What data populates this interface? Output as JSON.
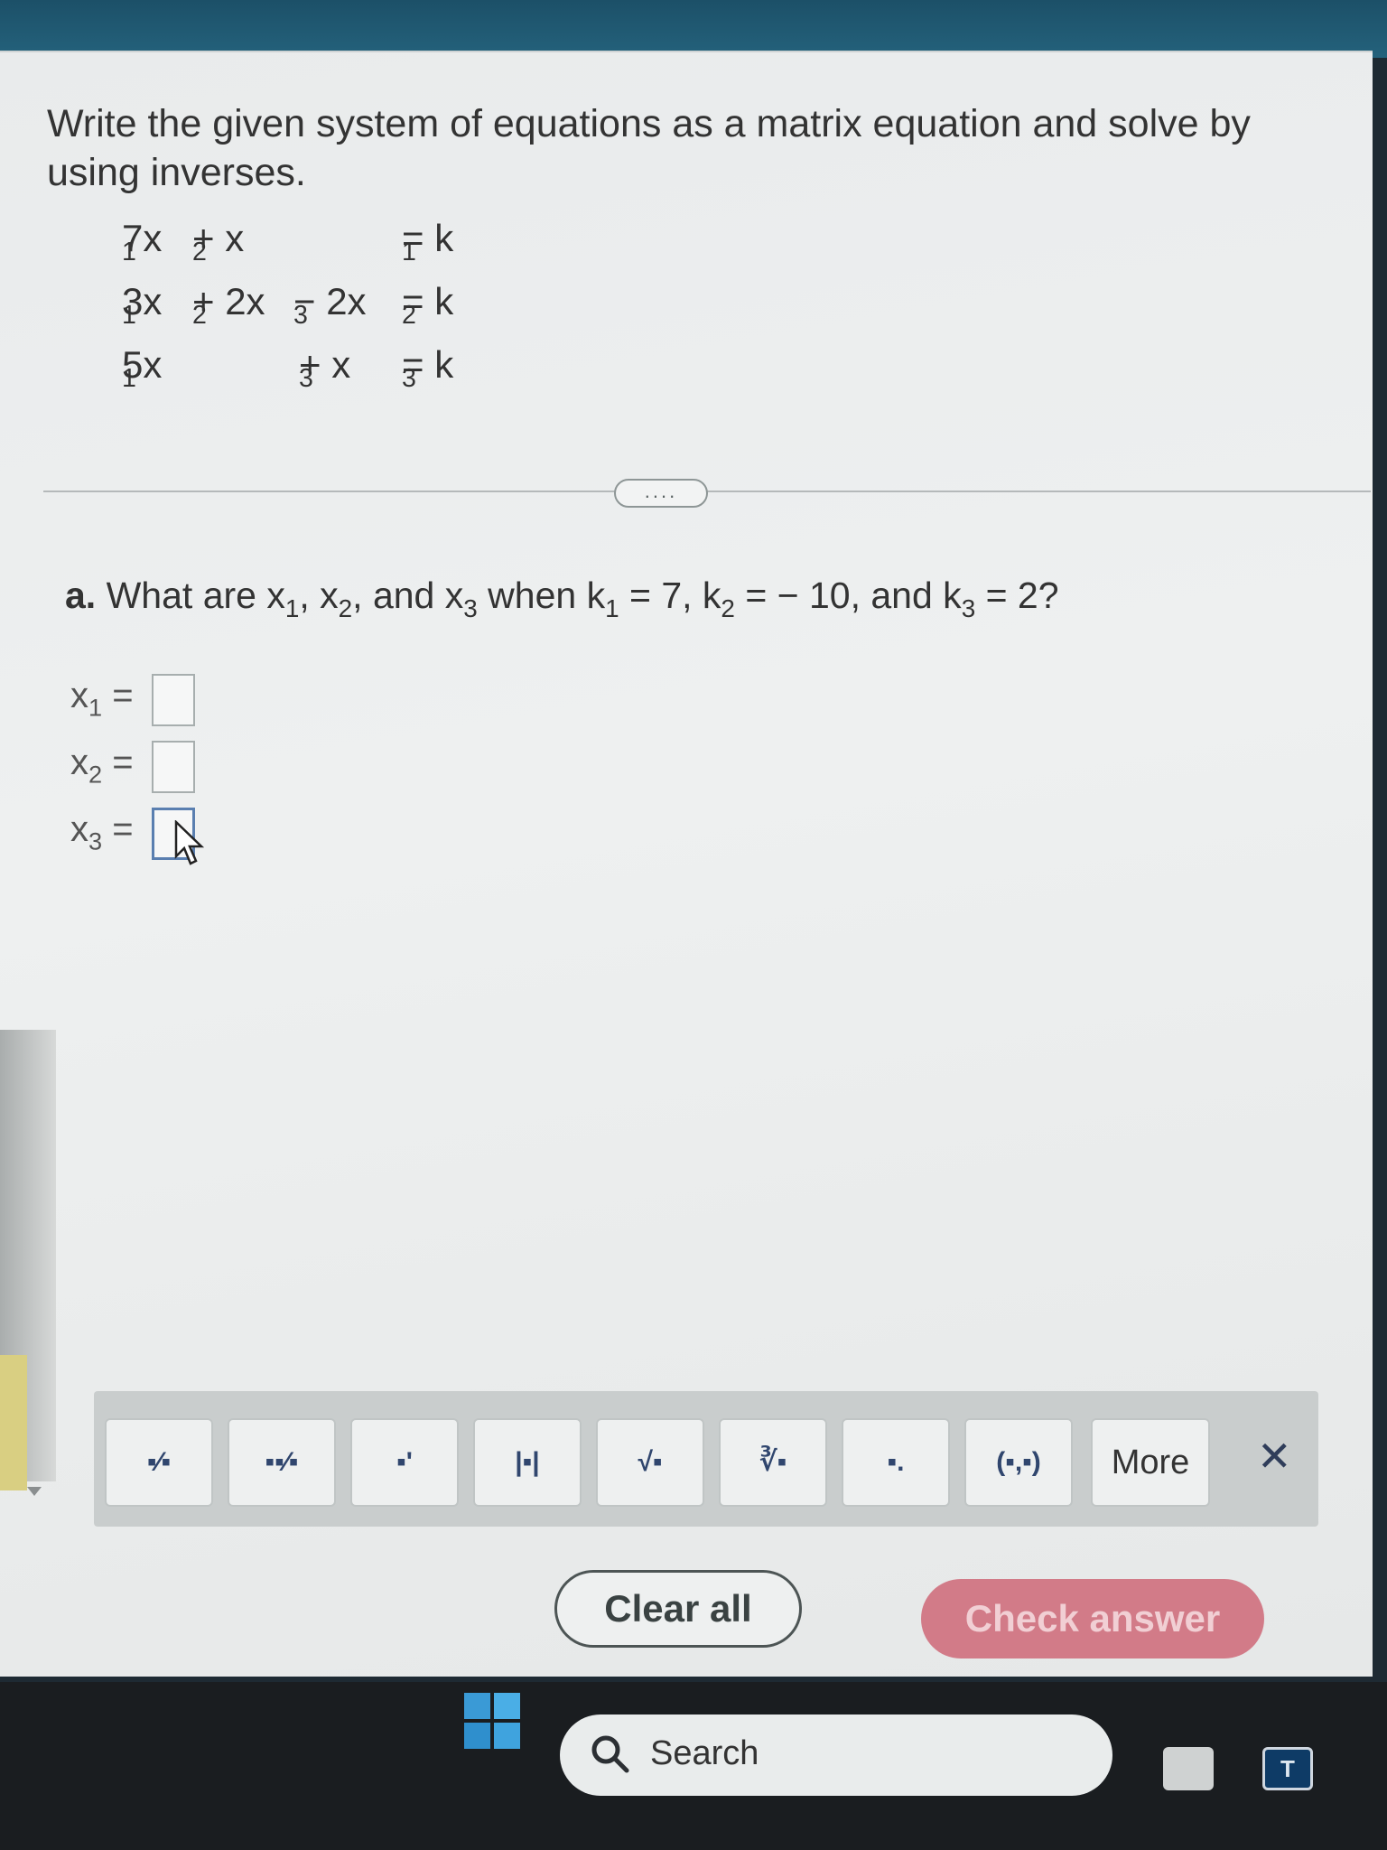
{
  "instructions": "Write the given system of equations as a matrix equation and solve by using inverses.",
  "system": {
    "row1": {
      "t1": "7x",
      "t1s": "1",
      "t2": "+ x",
      "t2s": "2",
      "rhs": "= k",
      "rhss": "1"
    },
    "row2": {
      "t1": "3x",
      "t1s": "1",
      "t2": "+ 2x",
      "t2s": "2",
      "t3": "− 2x",
      "t3s": "3",
      "rhs": "= k",
      "rhss": "2"
    },
    "row3": {
      "t1": "5x",
      "t1s": "1",
      "t3": "+ x",
      "t3s": "3",
      "rhs": "= k",
      "rhss": "3"
    }
  },
  "expand_button": "....",
  "question": {
    "label": "a.",
    "text": "What are x",
    "s1": "1",
    "c1": ", x",
    "s2": "2",
    "c2": ", and x",
    "s3": "3",
    "c3": " when k",
    "ks1": "1",
    "v1": " = 7, k",
    "ks2": "2",
    "v2": " = − 10, and k",
    "ks3": "3",
    "v3": " = 2?"
  },
  "answers": [
    {
      "var": "x",
      "sub": "1",
      "eq": " =",
      "value": ""
    },
    {
      "var": "x",
      "sub": "2",
      "eq": " =",
      "value": ""
    },
    {
      "var": "x",
      "sub": "3",
      "eq": " =",
      "value": ""
    }
  ],
  "toolbar": {
    "tools": [
      {
        "icon": "fraction-icon",
        "glyph": "▪⁄▪"
      },
      {
        "icon": "mixed-number-icon",
        "glyph": "▪▪⁄▪"
      },
      {
        "icon": "exponent-icon",
        "glyph": "▪'"
      },
      {
        "icon": "absolute-value-icon",
        "glyph": "|▪|"
      },
      {
        "icon": "square-root-icon",
        "glyph": "√▪"
      },
      {
        "icon": "nth-root-icon",
        "glyph": "∛▪"
      },
      {
        "icon": "decimal-icon",
        "glyph": "▪."
      },
      {
        "icon": "ordered-pair-icon",
        "glyph": "(▪,▪)"
      }
    ],
    "more_label": "More",
    "close_glyph": "✕"
  },
  "buttons": {
    "clear_all": "Clear all",
    "check_answer": "Check answer"
  },
  "taskbar": {
    "search_label": "Search",
    "app_letter": "T"
  }
}
